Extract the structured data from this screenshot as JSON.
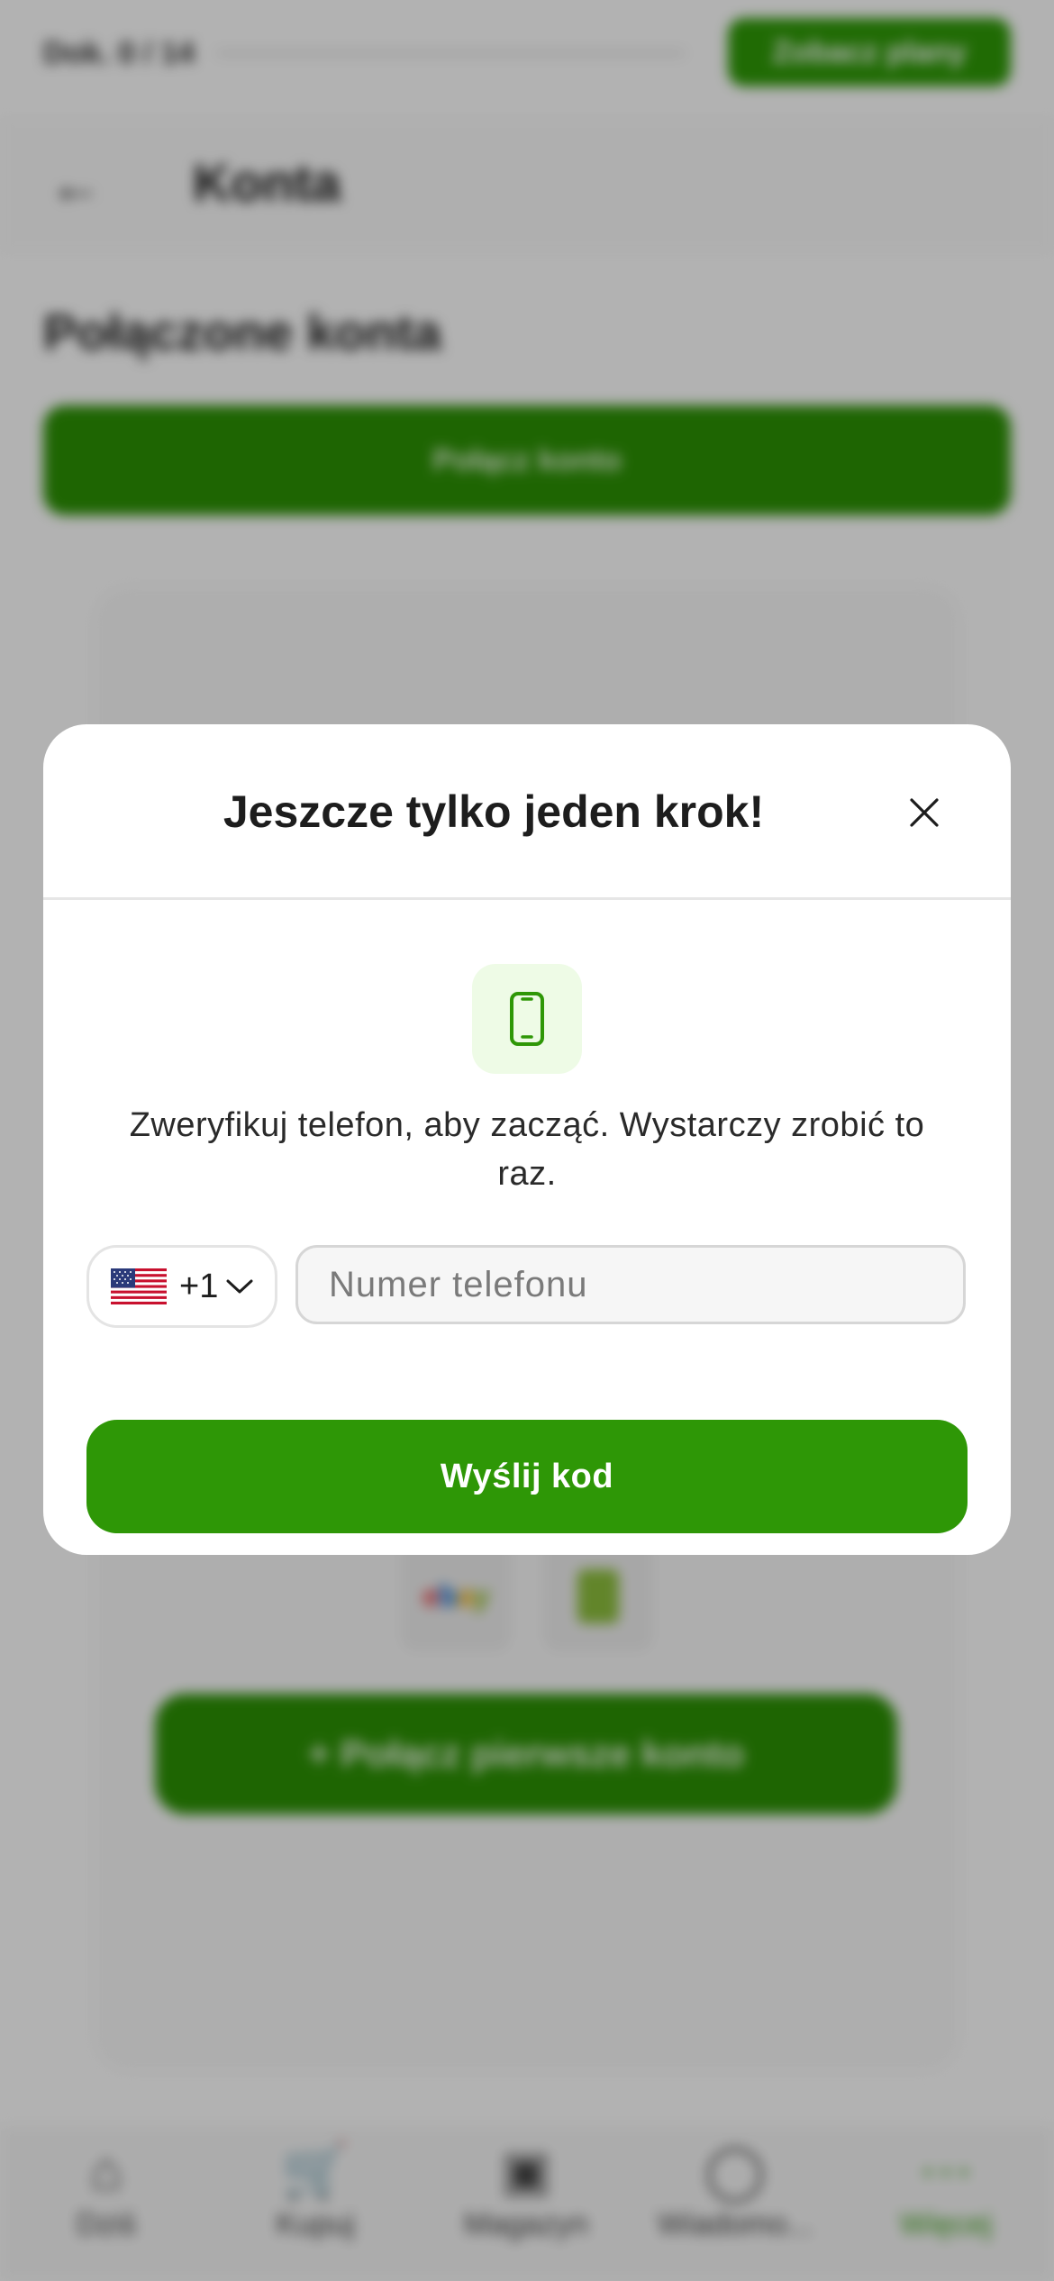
{
  "background": {
    "docs_counter": "Dok. 0 / 14",
    "upgrade_label": "Zobacz plany",
    "header_title": "Konta",
    "section_title": "Połączone konta",
    "connect_label": "Połącz konto",
    "first_account_label": "+ Połącz pierwsze konto",
    "tabs": [
      {
        "label": "Dziś",
        "icon": "home-icon"
      },
      {
        "label": "Kupuj",
        "icon": "cart-icon"
      },
      {
        "label": "Magazyn",
        "icon": "box-icon"
      },
      {
        "label": "Wiadomo...",
        "icon": "chat-icon"
      },
      {
        "label": "Więcej",
        "icon": "more-icon"
      }
    ]
  },
  "modal": {
    "title": "Jeszcze tylko jeden krok!",
    "description": "Zweryfikuj telefon, aby zacząć. Wystarczy zrobić to raz.",
    "country_code": "+1",
    "country_flag": "us-flag-icon",
    "phone_placeholder": "Numer telefonu",
    "phone_value": "",
    "send_label": "Wyślij kod"
  },
  "colors": {
    "accent": "#2e9706",
    "badge_bg": "#eefbe6"
  }
}
